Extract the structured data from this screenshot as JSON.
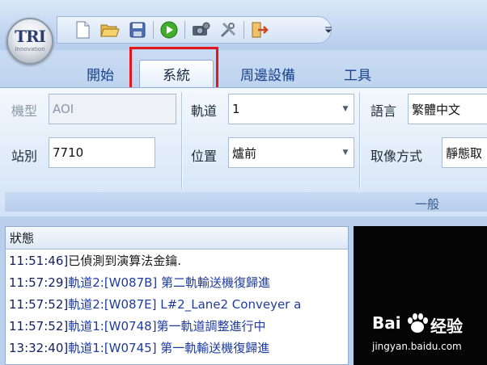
{
  "app": {
    "logo_text": "TRI",
    "logo_sub": "Innovation"
  },
  "quick_access": {
    "icons": [
      "new-file-icon",
      "open-folder-icon",
      "save-icon",
      "run-icon",
      "camera-settings-icon",
      "tools-icon",
      "exit-icon",
      "dropdown-icon"
    ]
  },
  "tabs": [
    {
      "label": "開始",
      "active": false
    },
    {
      "label": "系統",
      "active": true
    },
    {
      "label": "周邊設備",
      "active": false
    },
    {
      "label": "工具",
      "active": false
    }
  ],
  "ribbon": {
    "model_label": "機型",
    "model_value": "AOI",
    "station_label": "站別",
    "station_value": "7710",
    "track_label": "軌道",
    "track_value": "1",
    "position_label": "位置",
    "position_value": "爐前",
    "language_label": "語言",
    "language_value": "繁體中文",
    "capture_label": "取像方式",
    "capture_value": "靜態取",
    "group_label": "一般"
  },
  "status": {
    "title": "狀態",
    "lines": [
      {
        "time": "11:51:46]",
        "msg": "已偵測到演算法金鑰.",
        "plain": true
      },
      {
        "time": "11:57:29]",
        "msg": "軌道2:[W087B] 第二軌輸送機復歸進",
        "plain": false
      },
      {
        "time": "11:57:52]",
        "msg": "軌道2:[W087E] L#2_Lane2 Conveyer a",
        "plain": false
      },
      {
        "time": "11:57:52]",
        "msg": "軌道1:[W0748]第一軌道調整進行中",
        "plain": false
      },
      {
        "time": "13:32:40]",
        "msg": "軌道1:[W0745] 第一軌輸送機復歸進",
        "plain": false
      }
    ]
  },
  "watermark": {
    "brand": "Bai",
    "brand_cn": "经验",
    "url": "jingyan.baidu.com"
  },
  "colors": {
    "accent_tab_highlight": "#e3161c",
    "ribbon_text": "#15428b",
    "log_blue": "#1f3c9c"
  }
}
